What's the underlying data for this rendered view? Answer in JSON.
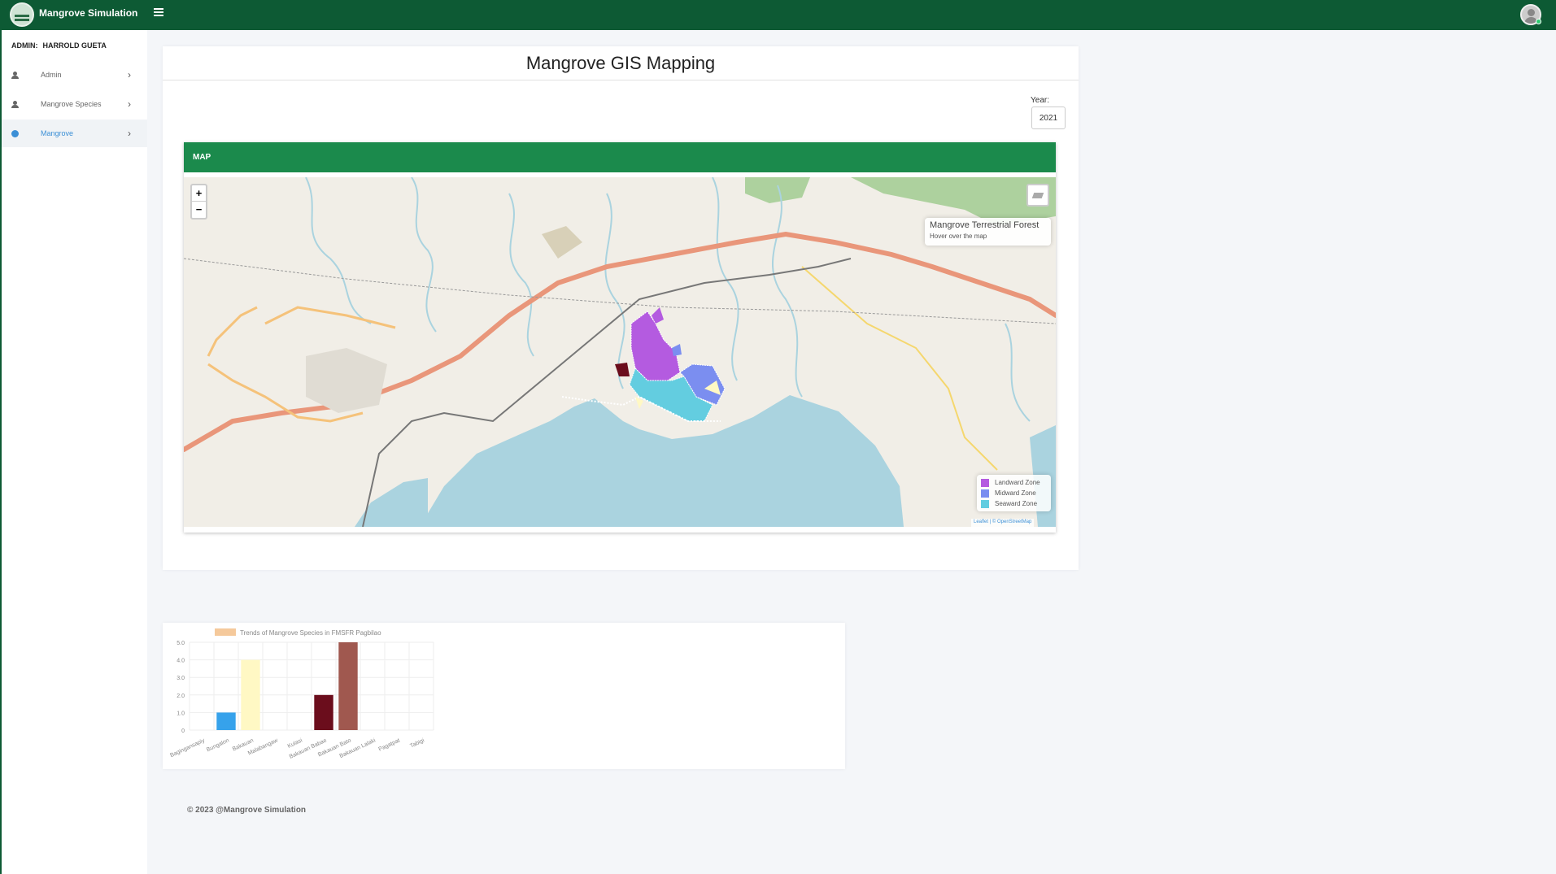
{
  "app": {
    "title": "Mangrove Simulation"
  },
  "sidebar": {
    "admin_prefix": "ADMIN:",
    "admin_name": "HARROLD GUETA",
    "items": [
      {
        "label": "Admin",
        "icon": "user-icon"
      },
      {
        "label": "Mangrove Species",
        "icon": "user-icon"
      },
      {
        "label": "Mangrove",
        "icon": "globe-icon",
        "active": true
      }
    ]
  },
  "page": {
    "title": "Mangrove GIS Mapping",
    "year_label": "Year:",
    "year_value": "2021"
  },
  "map": {
    "header": "MAP",
    "zoom_in": "+",
    "zoom_out": "−",
    "info_title": "Mangrove Terrestrial Forest",
    "info_hint": "Hover over the map",
    "legend": [
      {
        "label": "Landward Zone",
        "color": "#b45be0"
      },
      {
        "label": "Midward Zone",
        "color": "#7b8ef0"
      },
      {
        "label": "Seaward Zone",
        "color": "#63cde0"
      }
    ],
    "attribution": "Leaflet | © OpenStreetMap",
    "colors": {
      "sea": "#aad3df",
      "forest": "#add19e"
    }
  },
  "chart_data": {
    "type": "bar",
    "legend": "Trends of Mangrove Species in FMSFR Pagbilao",
    "categories": [
      "Bagingansapiy",
      "Bungalon",
      "Bakauan",
      "Malabangaw",
      "Kulasi",
      "Bakauan Babae",
      "Bakauan Bato",
      "Bakauan Lalaki",
      "Pagatpat",
      "Tabigi"
    ],
    "values": [
      0,
      1,
      4,
      0,
      0,
      2,
      5,
      0,
      0,
      0
    ],
    "colors": [
      "#36a2eb",
      "#36a2eb",
      "#fff8c4",
      "#cccccc",
      "#cccccc",
      "#6b0d1c",
      "#a0584f",
      "#cccccc",
      "#cccccc",
      "#cccccc"
    ],
    "ylim": [
      0,
      5
    ],
    "yticks": [
      "0",
      "1.0",
      "2.0",
      "3.0",
      "4.0",
      "5.0"
    ],
    "legend_color": "#f5c99b"
  },
  "footer": {
    "text": "© 2023 @Mangrove Simulation"
  }
}
